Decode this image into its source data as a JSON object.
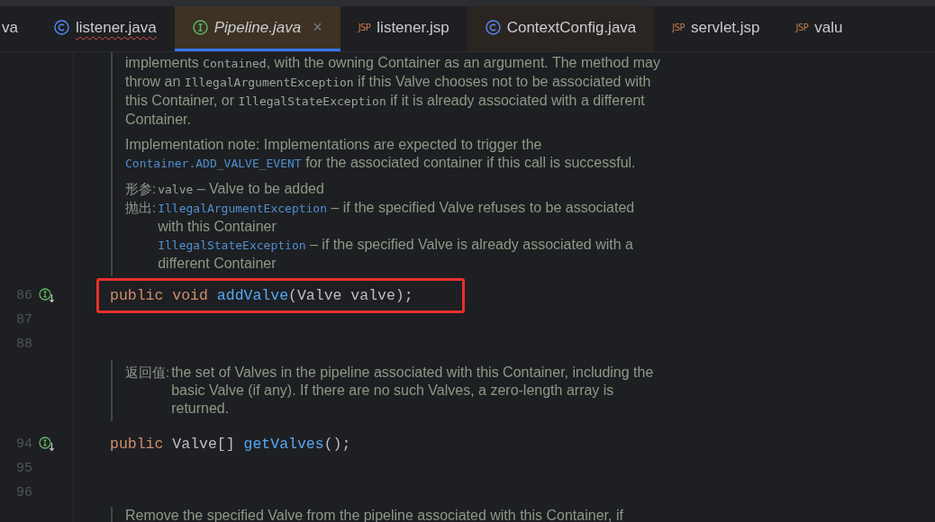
{
  "tabs": [
    {
      "label": "va",
      "kind": "none",
      "selected": false,
      "error": false,
      "highlighted": false
    },
    {
      "label": "listener.java",
      "kind": "class",
      "selected": false,
      "error": true,
      "highlighted": false
    },
    {
      "label": "Pipeline.java",
      "kind": "interface",
      "selected": true,
      "error": false,
      "highlighted": false,
      "close": "×"
    },
    {
      "label": "listener.jsp",
      "kind": "jsp",
      "badge": "JSP",
      "selected": false,
      "error": false,
      "highlighted": false
    },
    {
      "label": "ContextConfig.java",
      "kind": "class",
      "selected": false,
      "error": false,
      "highlighted": true
    },
    {
      "label": "servlet.jsp",
      "kind": "jsp",
      "badge": "JSP",
      "selected": false,
      "error": false,
      "highlighted": false
    },
    {
      "label": "valu",
      "kind": "jsp",
      "badge": "JSP",
      "selected": false,
      "error": false,
      "highlighted": false
    }
  ],
  "lines": [
    {
      "kind": "doc",
      "sections": [
        {
          "kind": "para",
          "segments": [
            {
              "kind": "text",
              "text": "implements "
            },
            {
              "kind": "code",
              "text": "Contained"
            },
            {
              "kind": "text",
              "text": ", with the owning Container as an argument. The method may throw an "
            },
            {
              "kind": "code",
              "text": "IllegalArgumentException"
            },
            {
              "kind": "text",
              "text": " if this Valve chooses not to be associated with this Container, or "
            },
            {
              "kind": "code",
              "text": "IllegalStateException"
            },
            {
              "kind": "text",
              "text": " if it is already associated with a different Container."
            }
          ]
        },
        {
          "kind": "para",
          "segments": [
            {
              "kind": "text",
              "text": "Implementation note: Implementations are expected to trigger the "
            },
            {
              "kind": "link",
              "text": "Container."
            },
            {
              "kind": "link",
              "text": "ADD_VALVE_EVENT"
            },
            {
              "kind": "text",
              "text": " for the associated container if this call is successful."
            }
          ]
        },
        {
          "kind": "tag",
          "label": "形参:",
          "entries": [
            [
              {
                "kind": "code",
                "text": "valve"
              },
              {
                "kind": "text",
                "text": " – Valve to be added"
              }
            ]
          ]
        },
        {
          "kind": "tag",
          "label": "抛出:",
          "entries": [
            [
              {
                "kind": "link",
                "text": "IllegalArgumentException"
              },
              {
                "kind": "text",
                "text": " – if the specified Valve refuses to be associated with this Container"
              }
            ],
            [
              {
                "kind": "link",
                "text": "IllegalStateException"
              },
              {
                "kind": "text",
                "text": " – if the specified Valve is already associated with a different Container"
              }
            ]
          ]
        }
      ]
    },
    {
      "kind": "code",
      "number": "86",
      "implemented": true,
      "boxed": true,
      "tokens": [
        {
          "kind": "keyword",
          "text": "public void"
        },
        {
          "kind": "method",
          "text": "addValve"
        },
        {
          "kind": "plain",
          "text": "(Valve valve);"
        }
      ]
    },
    {
      "kind": "code",
      "number": "87",
      "implemented": false,
      "boxed": false
    },
    {
      "kind": "code",
      "number": "88",
      "implemented": false,
      "boxed": false
    },
    {
      "kind": "doc",
      "sections": [
        {
          "kind": "tag",
          "label": "返回值:",
          "entries": [
            [
              {
                "kind": "text",
                "text": "the set of Valves in the pipeline associated with this Container, including the basic Valve (if any). If there are no such Valves, a zero-length array is returned."
              }
            ]
          ]
        }
      ]
    },
    {
      "kind": "code",
      "number": "94",
      "implemented": true,
      "boxed": false,
      "tokens": [
        {
          "kind": "keyword",
          "text": "public"
        },
        {
          "kind": "plain",
          "text": "Valve[]"
        },
        {
          "kind": "method",
          "text": "getValves"
        },
        {
          "kind": "plain",
          "text": "();"
        }
      ]
    },
    {
      "kind": "code",
      "number": "95",
      "implemented": false,
      "boxed": false
    },
    {
      "kind": "code",
      "number": "96",
      "implemented": false,
      "boxed": false
    },
    {
      "kind": "doc",
      "sections": [
        {
          "kind": "para",
          "segments": [
            {
              "kind": "text",
              "text": "Remove the specified Valve from the pipeline associated with this Container, if"
            }
          ]
        }
      ]
    }
  ]
}
